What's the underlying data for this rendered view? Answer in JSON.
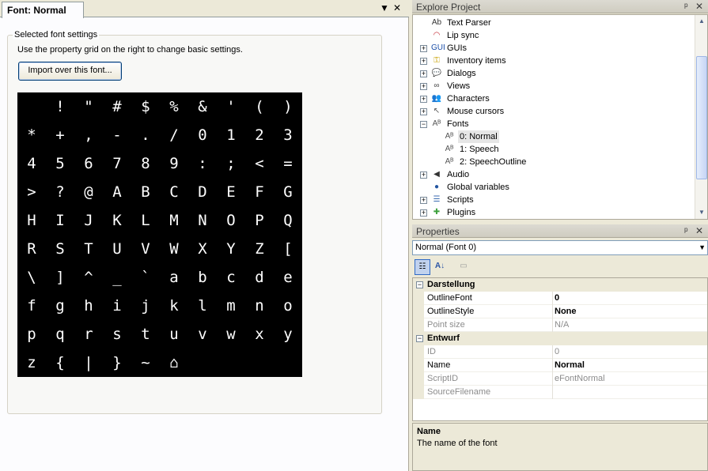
{
  "document": {
    "tab_title": "Font: Normal",
    "dropdown_glyph": "▼",
    "close_glyph": "✕",
    "group_title": "Selected font settings",
    "group_description": "Use the property grid on the right to change basic settings.",
    "import_button": "Import over this font...",
    "glyph_rows": [
      [
        " ",
        "!",
        "\"",
        "#",
        "$",
        "%",
        "&",
        "'",
        "(",
        ")"
      ],
      [
        "*",
        "+",
        ",",
        "-",
        ".",
        "/",
        "0",
        "1",
        "2",
        "3"
      ],
      [
        "4",
        "5",
        "6",
        "7",
        "8",
        "9",
        ":",
        ";",
        "<",
        "="
      ],
      [
        ">",
        "?",
        "@",
        "A",
        "B",
        "C",
        "D",
        "E",
        "F",
        "G"
      ],
      [
        "H",
        "I",
        "J",
        "K",
        "L",
        "M",
        "N",
        "O",
        "P",
        "Q"
      ],
      [
        "R",
        "S",
        "T",
        "U",
        "V",
        "W",
        "X",
        "Y",
        "Z",
        "["
      ],
      [
        "\\",
        "]",
        "^",
        "_",
        "`",
        "a",
        "b",
        "c",
        "d",
        "e"
      ],
      [
        "f",
        "g",
        "h",
        "i",
        "j",
        "k",
        "l",
        "m",
        "n",
        "o"
      ],
      [
        "p",
        "q",
        "r",
        "s",
        "t",
        "u",
        "v",
        "w",
        "x",
        "y"
      ],
      [
        "z",
        "{",
        "|",
        "}",
        "~",
        "⌂"
      ]
    ]
  },
  "explore": {
    "title": "Explore Project",
    "pin_glyph": "ᵖ",
    "close_glyph": "✕",
    "items": [
      {
        "label": "Text Parser",
        "icon": "text-parser-icon",
        "glyph": "Ab",
        "color": "#333"
      },
      {
        "label": "Lip sync",
        "icon": "lips-icon",
        "glyph": "◠",
        "color": "#c0202a"
      },
      {
        "label": "GUIs",
        "icon": "gui-icon",
        "glyph": "GUI",
        "color": "#1c4fa8"
      },
      {
        "label": "Inventory items",
        "icon": "key-icon",
        "glyph": "⚿",
        "color": "#c8a000"
      },
      {
        "label": "Dialogs",
        "icon": "speech-bubble-icon",
        "glyph": "💬",
        "color": "#2a7fd6"
      },
      {
        "label": "Views",
        "icon": "glasses-icon",
        "glyph": "∞",
        "color": "#444"
      },
      {
        "label": "Characters",
        "icon": "characters-icon",
        "glyph": "👥",
        "color": "#8a4b1e"
      },
      {
        "label": "Mouse cursors",
        "icon": "cursor-icon",
        "glyph": "↖",
        "color": "#555"
      },
      {
        "label": "Fonts",
        "icon": "font-icon",
        "glyph": "Aᴮ",
        "color": "#555"
      },
      {
        "label": "0: Normal",
        "icon": "font-icon",
        "glyph": "Aᴮ",
        "color": "#555"
      },
      {
        "label": "1: Speech",
        "icon": "font-icon",
        "glyph": "Aᴮ",
        "color": "#555"
      },
      {
        "label": "2: SpeechOutline",
        "icon": "font-icon",
        "glyph": "Aᴮ",
        "color": "#555"
      },
      {
        "label": "Audio",
        "icon": "speaker-icon",
        "glyph": "◀",
        "color": "#333"
      },
      {
        "label": "Global variables",
        "icon": "globe-icon",
        "glyph": "●",
        "color": "#2355a0"
      },
      {
        "label": "Scripts",
        "icon": "scripts-icon",
        "glyph": "☰",
        "color": "#3a6ab0"
      },
      {
        "label": "Plugins",
        "icon": "plugin-icon",
        "glyph": "✚",
        "color": "#3ca03c"
      }
    ]
  },
  "properties": {
    "title": "Properties",
    "pin_glyph": "ᵖ",
    "close_glyph": "✕",
    "selected_object": "Normal (Font 0)",
    "combo_glyph": "▼",
    "tb_alpha": "A↓",
    "tb_categorized": "☷",
    "tb_pages": "▭",
    "categories": {
      "darstellung": "Darstellung",
      "entwurf": "Entwurf"
    },
    "rows": {
      "outline_font": {
        "name": "OutlineFont",
        "value": "0"
      },
      "outline_style": {
        "name": "OutlineStyle",
        "value": "None"
      },
      "point_size": {
        "name": "Point size",
        "value": "N/A"
      },
      "id": {
        "name": "ID",
        "value": "0"
      },
      "name": {
        "name": "Name",
        "value": "Normal"
      },
      "script_id": {
        "name": "ScriptID",
        "value": "eFontNormal"
      },
      "source_filename": {
        "name": "SourceFilename",
        "value": ""
      }
    },
    "help_title": "Name",
    "help_desc": "The name of the font"
  }
}
